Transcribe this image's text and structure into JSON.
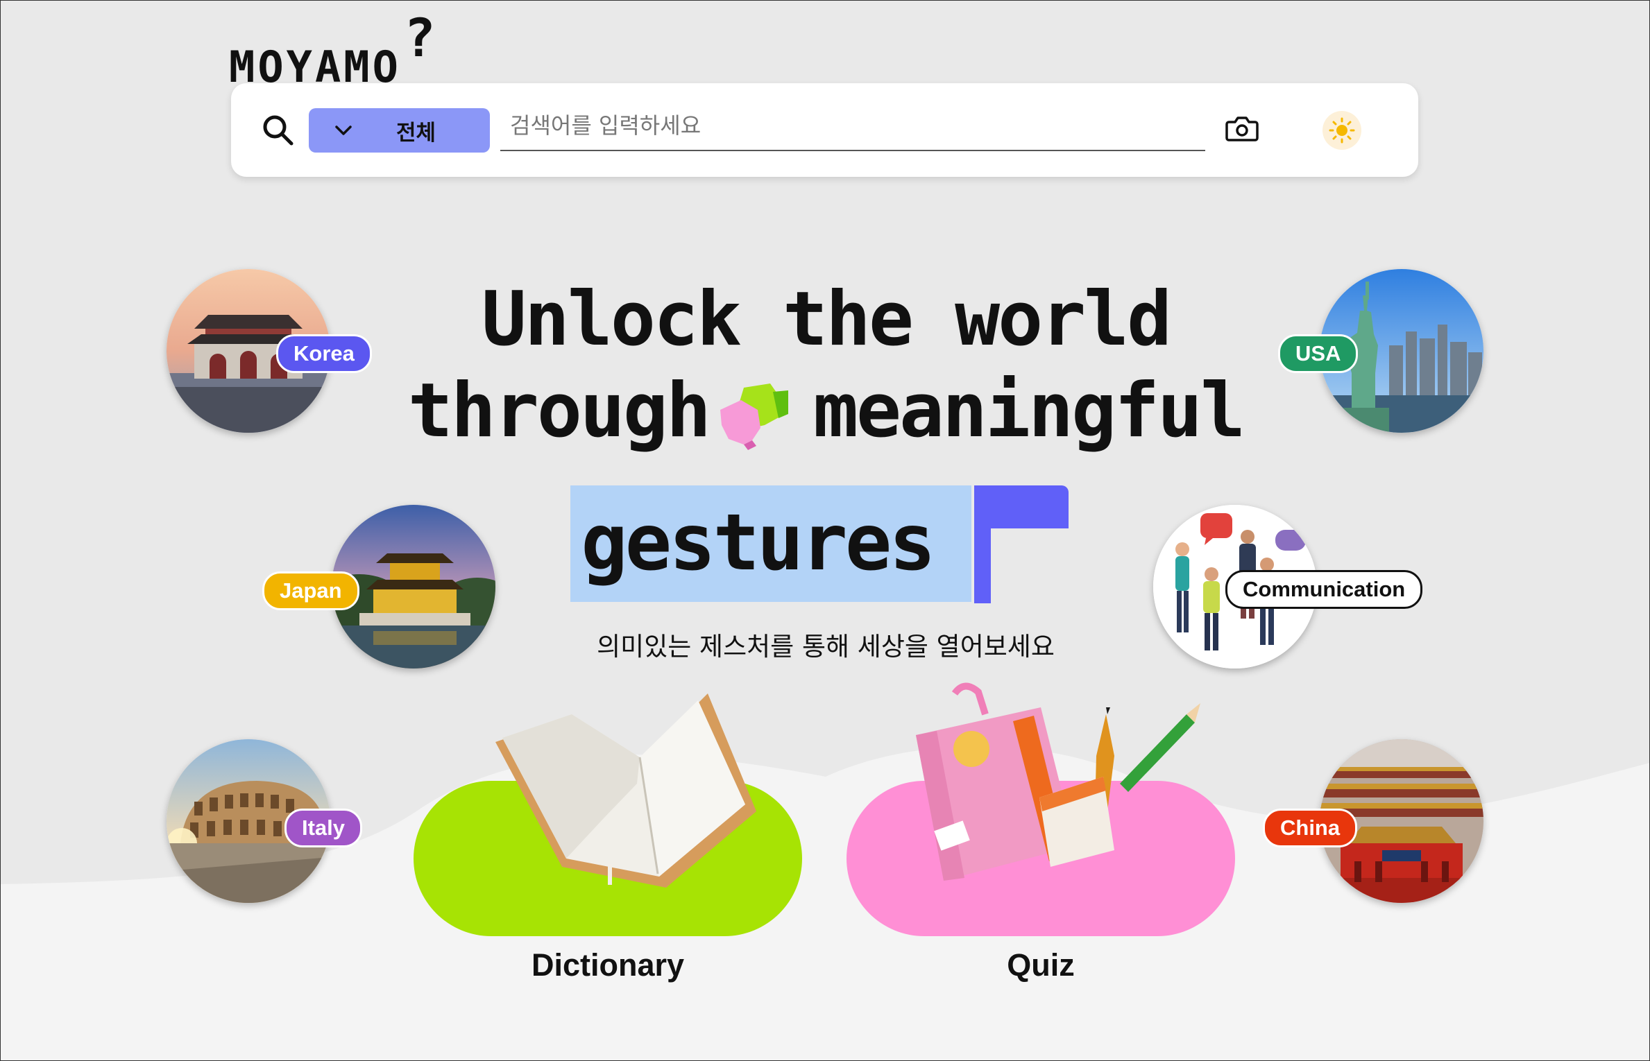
{
  "app": {
    "logo_text": "MOYAMO",
    "logo_mark": "?"
  },
  "search": {
    "category_selected": "전체",
    "placeholder": "검색어를 입력하세요",
    "icons": [
      "search-icon",
      "chevron-down-icon",
      "camera-icon",
      "sun-icon"
    ]
  },
  "hero": {
    "line1": "Unlock the world",
    "line2_a": "through",
    "line2_b": "meaningful",
    "line3": "gestures",
    "subtitle": "의미있는 제스처를 통해 세상을 열어보세요"
  },
  "places": [
    {
      "label": "Korea",
      "color": "#5b57f0"
    },
    {
      "label": "Japan",
      "color": "#f2b400"
    },
    {
      "label": "Italy",
      "color": "#a055c8"
    },
    {
      "label": "USA",
      "color": "#1f9a63"
    },
    {
      "label": "Communication",
      "color": "#ffffff"
    },
    {
      "label": "China",
      "color": "#e8360c"
    }
  ],
  "cards": {
    "dictionary": {
      "label": "Dictionary",
      "color": "#a7e304"
    },
    "quiz": {
      "label": "Quiz",
      "color": "#ff8fd5"
    }
  },
  "colors": {
    "accent_purple": "#8b97f7",
    "gestures_box": "#b3d3f7",
    "cursor_block": "#6060f8"
  }
}
